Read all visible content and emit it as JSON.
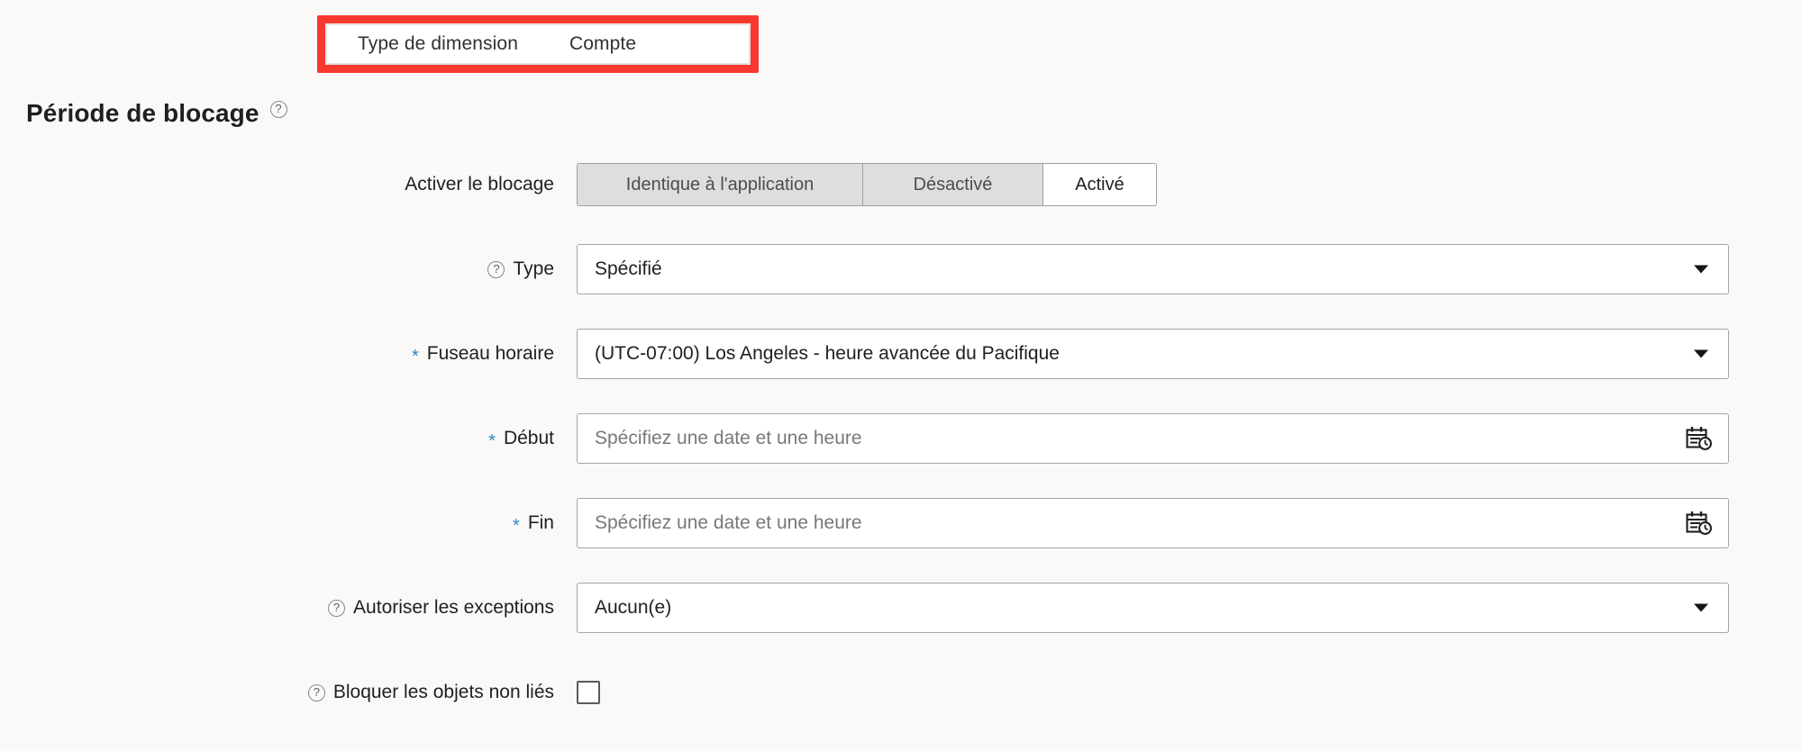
{
  "tooltip": {
    "col1": "Type de dimension",
    "col2": "Compte",
    "highlight_color": "#f8392f"
  },
  "section": {
    "title": "Période de blocage",
    "help_icon": "help-circle-icon"
  },
  "form": {
    "enable_block": {
      "label": "Activer le blocage",
      "options": [
        {
          "label": "Identique à l'application",
          "selected": false
        },
        {
          "label": "Désactivé",
          "selected": false
        },
        {
          "label": "Activé",
          "selected": true
        }
      ]
    },
    "type": {
      "label": "Type",
      "value": "Spécifié",
      "help_icon": "help-circle-icon",
      "caret_icon": "chevron-down-icon"
    },
    "timezone": {
      "label": "Fuseau horaire",
      "required_mark": "*",
      "value": "(UTC-07:00) Los Angeles - heure avancée du Pacifique",
      "caret_icon": "chevron-down-icon"
    },
    "start": {
      "label": "Début",
      "required_mark": "*",
      "value": "",
      "placeholder": "Spécifiez une date et une heure",
      "icon": "calendar-clock-icon"
    },
    "end": {
      "label": "Fin",
      "required_mark": "*",
      "value": "",
      "placeholder": "Spécifiez une date et une heure",
      "icon": "calendar-clock-icon"
    },
    "allow_exceptions": {
      "label": "Autoriser les exceptions",
      "value": "Aucun(e)",
      "help_icon": "help-circle-icon",
      "caret_icon": "chevron-down-icon"
    },
    "block_unrelated": {
      "label": "Bloquer les objets non liés",
      "help_icon": "help-circle-icon",
      "checked": false
    }
  },
  "colors": {
    "background": "#faf9f8",
    "required_star": "#2a8ac7",
    "highlight": "#f8392f",
    "text": "#201f1e"
  }
}
